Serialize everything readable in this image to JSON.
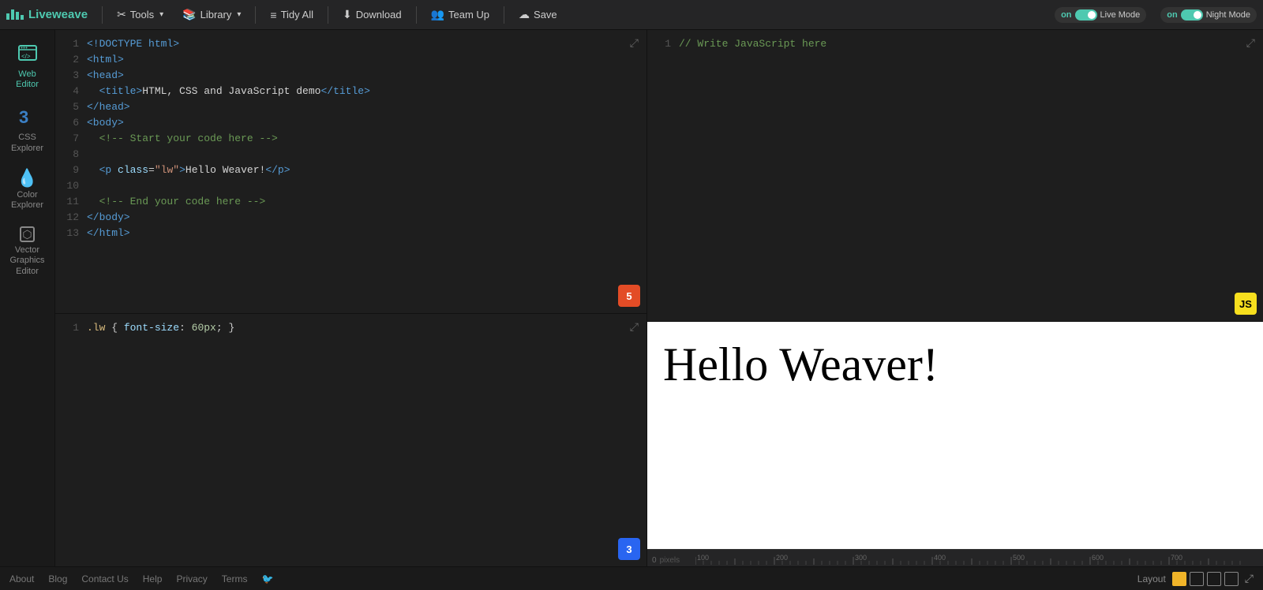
{
  "brand": {
    "name": "Liveweave"
  },
  "nav": {
    "tools_label": "Tools",
    "library_label": "Library",
    "tidy_label": "Tidy All",
    "download_label": "Download",
    "teamup_label": "Team Up",
    "save_label": "Save"
  },
  "toggles": {
    "live_mode_on": "on",
    "live_mode_label": "Live Mode",
    "night_mode_on": "on",
    "night_mode_label": "Night Mode"
  },
  "sidebar": {
    "web_editor_label": "Web\nEditor",
    "css_explorer_label": "CSS\nExplorer",
    "color_explorer_label": "Color\nExplorer",
    "vector_graphics_label": "Vector\nGraphics\nEditor"
  },
  "html_editor": {
    "lines": [
      {
        "num": "1",
        "content": "<!DOCTYPE html>"
      },
      {
        "num": "2",
        "content": "<html>"
      },
      {
        "num": "3",
        "content": "<head>"
      },
      {
        "num": "4",
        "content": "  <title>HTML, CSS and JavaScript demo</title>"
      },
      {
        "num": "5",
        "content": "</head>"
      },
      {
        "num": "6",
        "content": "<body>"
      },
      {
        "num": "7",
        "content": "  <!-- Start your code here -->"
      },
      {
        "num": "8",
        "content": ""
      },
      {
        "num": "9",
        "content": "  <p class=\"lw\">Hello Weaver!</p>"
      },
      {
        "num": "10",
        "content": ""
      },
      {
        "num": "11",
        "content": "  <!-- End your code here -->"
      },
      {
        "num": "12",
        "content": "</body>"
      },
      {
        "num": "13",
        "content": "</html>"
      }
    ]
  },
  "css_editor": {
    "lines": [
      {
        "num": "1",
        "content": ".lw { font-size: 60px; }"
      }
    ]
  },
  "js_editor": {
    "lines": [
      {
        "num": "1",
        "content": "// Write JavaScript here"
      }
    ]
  },
  "preview": {
    "text": "Hello Weaver!"
  },
  "ruler": {
    "zero_label": "0",
    "pixels_label": "pixels",
    "ticks": [
      "100",
      "200",
      "300",
      "400",
      "500",
      "600",
      "700"
    ]
  },
  "footer": {
    "about_label": "About",
    "blog_label": "Blog",
    "contact_label": "Contact Us",
    "help_label": "Help",
    "privacy_label": "Privacy",
    "terms_label": "Terms",
    "layout_label": "Layout"
  }
}
